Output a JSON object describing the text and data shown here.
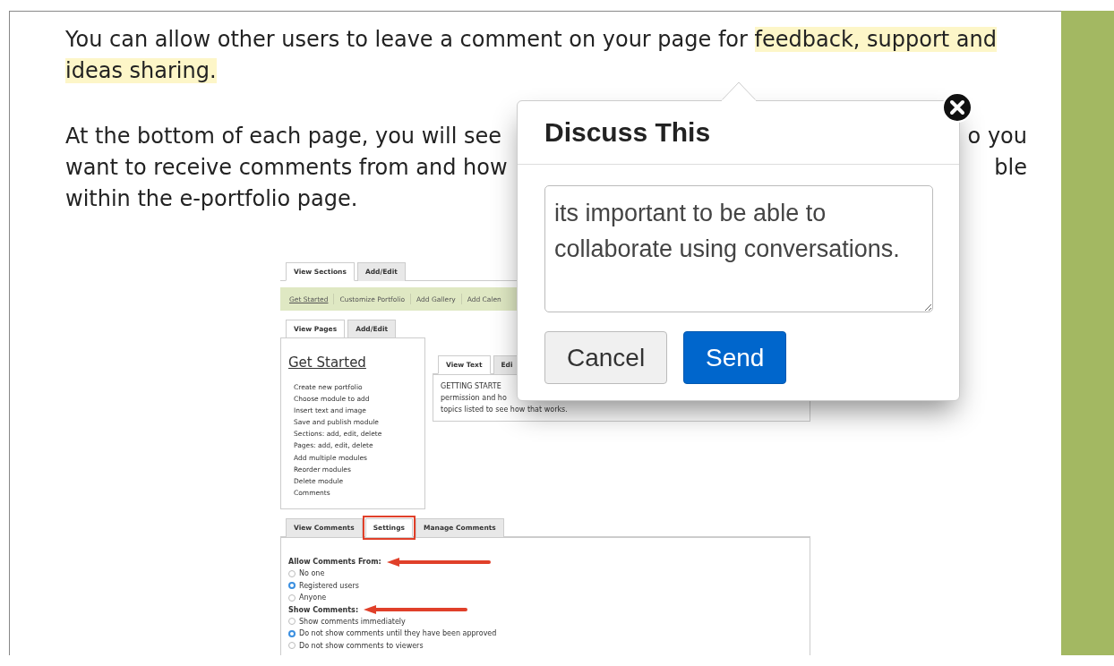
{
  "article": {
    "intro": [
      {
        "text": "You can allow other users to leave a comment on your page for ",
        "highlighted": false
      },
      {
        "text": "feedback, support and ideas sharing.",
        "highlighted": true
      }
    ],
    "para_lines": [
      {
        "left": "At the bottom of each page, you will see",
        "right": "o you"
      },
      {
        "left": "want to receive comments from and how",
        "right": "ble"
      },
      {
        "left": "within the e-portfolio page."
      }
    ]
  },
  "screenshot": {
    "section_tabs": [
      {
        "label": "View Sections",
        "selected": true
      },
      {
        "label": "Add/Edit",
        "selected": false
      }
    ],
    "nav_links": [
      {
        "label": "Get Started",
        "selected": true
      },
      {
        "label": "Customize Portfolio",
        "selected": false
      },
      {
        "label": "Add Gallery",
        "selected": false
      },
      {
        "label": "Add Calen",
        "selected": false
      }
    ],
    "page_tabs": [
      {
        "label": "View Pages",
        "selected": true
      },
      {
        "label": "Add/Edit",
        "selected": false
      }
    ],
    "page_title": "Get Started",
    "topics": [
      "Create new portfolio",
      "Choose module to add",
      "Insert text and image",
      "Save and publish module",
      "Sections: add, edit, delete",
      "Pages: add, edit, delete",
      "Add multiple modules",
      "Reorder modules",
      "Delete module",
      "Comments"
    ],
    "text_tabs": [
      {
        "label": "View Text",
        "selected": true
      },
      {
        "label": "Edi",
        "selected": false
      }
    ],
    "text_lines": [
      "GETTING STARTE",
      "permission and ho",
      "topics listed to see how that works."
    ],
    "comment_tabs": [
      {
        "label": "View Comments",
        "selected": false,
        "annotated": false
      },
      {
        "label": "Settings",
        "selected": true,
        "annotated": true
      },
      {
        "label": "Manage Comments",
        "selected": false,
        "annotated": false
      }
    ],
    "settings": [
      {
        "heading": "Allow Comments From:",
        "arrow": true,
        "options": [
          {
            "label": "No one",
            "selected": false
          },
          {
            "label": "Registered users",
            "selected": true
          },
          {
            "label": "Anyone",
            "selected": false
          }
        ]
      },
      {
        "heading": "Show Comments:",
        "arrow": true,
        "options": [
          {
            "label": "Show comments immediately",
            "selected": false
          },
          {
            "label": "Do not show comments until they have been approved",
            "selected": true
          },
          {
            "label": "Do not show comments to viewers",
            "selected": false
          }
        ]
      }
    ]
  },
  "dialog": {
    "title": "Discuss This",
    "message": "its important to be able to collaborate using conversations.",
    "buttons": [
      {
        "label": "Cancel",
        "kind": "secondary"
      },
      {
        "label": "Send",
        "kind": "primary"
      }
    ]
  }
}
